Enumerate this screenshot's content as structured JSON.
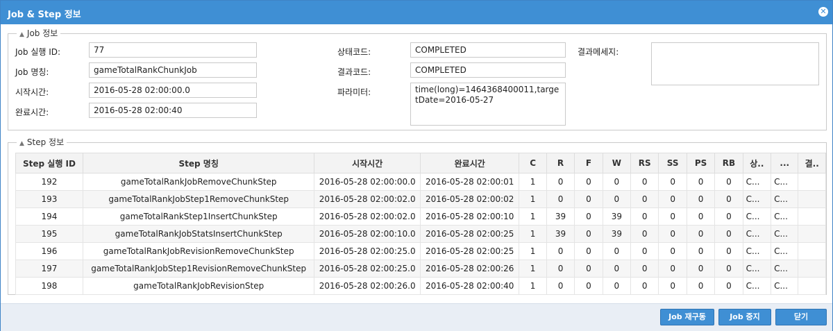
{
  "window": {
    "title": "Job & Step 정보",
    "close_glyph": "✕"
  },
  "job_section": {
    "legend": "Job 정보",
    "exec_id_label": "Job 실행 ID:",
    "exec_id": "77",
    "name_label": "Job 명칭:",
    "name": "gameTotalRankChunkJob",
    "start_label": "시작시간:",
    "start": "2016-05-28 02:00:00.0",
    "end_label": "완료시간:",
    "end": "2016-05-28 02:00:40",
    "status_label": "상태코드:",
    "status": "COMPLETED",
    "exit_label": "결과코드:",
    "exit": "COMPLETED",
    "param_label": "파라미터:",
    "param": "time(long)=1464368400011,targetDate=2016-05-27",
    "message_label": "결과메세지:",
    "message": ""
  },
  "step_section": {
    "legend": "Step 정보",
    "columns": [
      "Step 실행 ID",
      "Step 명칭",
      "시작시간",
      "완료시간",
      "C",
      "R",
      "F",
      "W",
      "RS",
      "SS",
      "PS",
      "RB",
      "상..",
      "...",
      "결.."
    ],
    "rows": [
      [
        "192",
        "gameTotalRankJobRemoveChunkStep",
        "2016-05-28 02:00:00.0",
        "2016-05-28 02:00:01",
        "1",
        "0",
        "0",
        "0",
        "0",
        "0",
        "0",
        "0",
        "C...",
        "C...",
        ""
      ],
      [
        "193",
        "gameTotalRankJobStep1RemoveChunkStep",
        "2016-05-28 02:00:02.0",
        "2016-05-28 02:00:02",
        "1",
        "0",
        "0",
        "0",
        "0",
        "0",
        "0",
        "0",
        "C...",
        "C...",
        ""
      ],
      [
        "194",
        "gameTotalRankStep1InsertChunkStep",
        "2016-05-28 02:00:02.0",
        "2016-05-28 02:00:10",
        "1",
        "39",
        "0",
        "39",
        "0",
        "0",
        "0",
        "0",
        "C...",
        "C...",
        ""
      ],
      [
        "195",
        "gameTotalRankJobStatsInsertChunkStep",
        "2016-05-28 02:00:10.0",
        "2016-05-28 02:00:25",
        "1",
        "39",
        "0",
        "39",
        "0",
        "0",
        "0",
        "0",
        "C...",
        "C...",
        ""
      ],
      [
        "196",
        "gameTotalRankJobRevisionRemoveChunkStep",
        "2016-05-28 02:00:25.0",
        "2016-05-28 02:00:25",
        "1",
        "0",
        "0",
        "0",
        "0",
        "0",
        "0",
        "0",
        "C...",
        "C...",
        ""
      ],
      [
        "197",
        "gameTotalRankJobStep1RevisionRemoveChunkStep",
        "2016-05-28 02:00:25.0",
        "2016-05-28 02:00:26",
        "1",
        "0",
        "0",
        "0",
        "0",
        "0",
        "0",
        "0",
        "C...",
        "C...",
        ""
      ],
      [
        "198",
        "gameTotalRankJobRevisionStep",
        "2016-05-28 02:00:26.0",
        "2016-05-28 02:00:40",
        "1",
        "0",
        "0",
        "0",
        "0",
        "0",
        "0",
        "0",
        "C...",
        "C...",
        ""
      ]
    ]
  },
  "footer": {
    "restart_label": "Job 재구동",
    "stop_label": "Job 중지",
    "close_label": "닫기"
  },
  "colors": {
    "accent": "#3f8fd4",
    "border": "#c9c9c9",
    "footer_bg": "#e9eef5"
  }
}
